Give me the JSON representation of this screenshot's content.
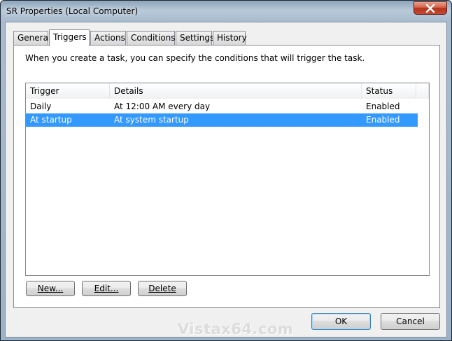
{
  "window": {
    "title": "SR Properties (Local Computer)"
  },
  "tabs": [
    {
      "label": "General"
    },
    {
      "label": "Triggers",
      "active": true
    },
    {
      "label": "Actions"
    },
    {
      "label": "Conditions"
    },
    {
      "label": "Settings"
    },
    {
      "label": "History"
    }
  ],
  "panel": {
    "description": "When you create a task, you can specify the conditions that will trigger the task."
  },
  "list": {
    "columns": [
      "Trigger",
      "Details",
      "Status"
    ],
    "rows": [
      {
        "trigger": "Daily",
        "details": "At 12:00 AM every day",
        "status": "Enabled",
        "selected": false
      },
      {
        "trigger": "At startup",
        "details": "At system startup",
        "status": "Enabled",
        "selected": true
      }
    ]
  },
  "buttons": {
    "new_label": "New...",
    "edit_label": "Edit...",
    "delete_label": "Delete",
    "ok_label": "OK",
    "cancel_label": "Cancel"
  },
  "watermark": "Vistax64.com",
  "colors": {
    "selection": "#3399ff",
    "close_button": "#c74a32"
  }
}
